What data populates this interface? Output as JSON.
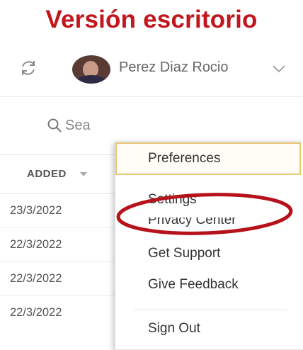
{
  "caption": "Versión escritorio",
  "header": {
    "user_name": "Perez Diaz Rocio",
    "icons": {
      "refresh": "refresh-icon",
      "dropdown": "chevron-down-icon",
      "avatar": "user-avatar"
    }
  },
  "search": {
    "placeholder": "Sea",
    "icon": "search-icon"
  },
  "table": {
    "column_header": "ADDED",
    "sort_icon": "sort-down-icon",
    "rows": [
      "23/3/2022",
      "22/3/2022",
      "22/3/2022",
      "22/3/2022"
    ]
  },
  "menu": {
    "items": [
      {
        "label": "Preferences"
      },
      {
        "label": "Settings"
      },
      {
        "label": "Privacy Center"
      },
      {
        "label": "Get Support"
      },
      {
        "label": "Give Feedback"
      },
      {
        "label": "Sign Out"
      }
    ]
  },
  "colors": {
    "caption": "#c0161c",
    "highlight_ellipse": "#b5121b",
    "focus_outline": "#e8c777"
  }
}
